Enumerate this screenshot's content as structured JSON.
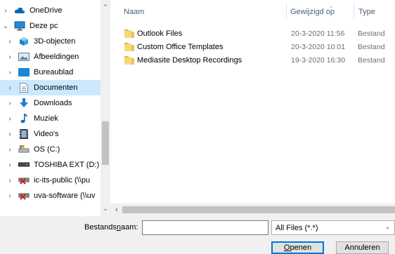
{
  "nav": {
    "items": [
      {
        "label": "OneDrive",
        "icon": "onedrive-cloud-icon",
        "chevron": ">",
        "level": 0
      },
      {
        "label": "Deze pc",
        "icon": "computer-icon",
        "chevron": "v",
        "level": 0
      },
      {
        "label": "3D-objecten",
        "icon": "3d-objects-icon",
        "chevron": ">",
        "level": 1
      },
      {
        "label": "Afbeeldingen",
        "icon": "pictures-icon",
        "chevron": ">",
        "level": 1
      },
      {
        "label": "Bureaublad",
        "icon": "desktop-icon",
        "chevron": ">",
        "level": 1
      },
      {
        "label": "Documenten",
        "icon": "documents-icon",
        "chevron": ">",
        "level": 1,
        "selected": true
      },
      {
        "label": "Downloads",
        "icon": "downloads-icon",
        "chevron": ">",
        "level": 1
      },
      {
        "label": "Muziek",
        "icon": "music-icon",
        "chevron": ">",
        "level": 1
      },
      {
        "label": "Video's",
        "icon": "videos-icon",
        "chevron": ">",
        "level": 1
      },
      {
        "label": "OS (C:)",
        "icon": "drive-c-icon",
        "chevron": ">",
        "level": 1
      },
      {
        "label": "TOSHIBA EXT (D:)",
        "icon": "external-drive-icon",
        "chevron": ">",
        "level": 1
      },
      {
        "label": "ic-its-public (\\\\pu",
        "icon": "network-drive-disconnected-icon",
        "chevron": ">",
        "level": 1
      },
      {
        "label": "uva-software (\\\\uv",
        "icon": "network-drive-disconnected-icon",
        "chevron": ">",
        "level": 1
      }
    ]
  },
  "columns": {
    "name": "Naam",
    "modified": "Gewijzigd op",
    "type": "Type"
  },
  "files": [
    {
      "name": "Outlook Files",
      "modified": "20-3-2020 11:56",
      "type": "Bestand"
    },
    {
      "name": "Custom Office Templates",
      "modified": "20-3-2020 10:01",
      "type": "Bestand"
    },
    {
      "name": "Mediasite Desktop Recordings",
      "modified": "19-3-2020 16:30",
      "type": "Bestand"
    }
  ],
  "footer": {
    "filename_label_prefix": "Bestands",
    "filename_label_accel": "n",
    "filename_label_suffix": "aam:",
    "filename_value": "",
    "filter_value": "All Files (*.*)",
    "open_accel": "O",
    "open_rest": "penen",
    "cancel_label": "Annuleren"
  },
  "colors": {
    "selected_bg": "#cce8ff",
    "header_text": "#4c607a",
    "folder_yellow": "#f8d775",
    "accent": "#0078d7"
  }
}
